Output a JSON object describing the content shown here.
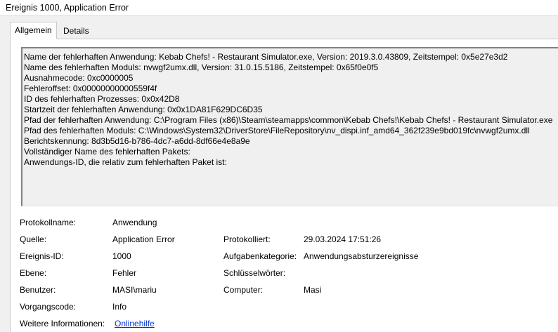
{
  "window": {
    "title": "Ereignis 1000, Application Error"
  },
  "tabs": [
    {
      "label": "Allgemein",
      "active": true
    },
    {
      "label": "Details",
      "active": false
    }
  ],
  "description": {
    "lines": [
      "Name der fehlerhaften Anwendung: Kebab Chefs! - Restaurant Simulator.exe, Version: 2019.3.0.43809, Zeitstempel: 0x5e27e3d2",
      "Name des fehlerhaften Moduls: nvwgf2umx.dll, Version: 31.0.15.5186, Zeitstempel: 0x65f0e0f5",
      "Ausnahmecode: 0xc0000005",
      "Fehleroffset: 0x00000000000559f4f",
      "ID des fehlerhaften Prozesses: 0x0x42D8",
      "Startzeit der fehlerhaften Anwendung: 0x0x1DA81F629DC6D35",
      "Pfad der fehlerhaften Anwendung: C:\\Program Files (x86)\\Steam\\steamapps\\common\\Kebab Chefs!\\Kebab Chefs! - Restaurant Simulator.exe",
      "Pfad des fehlerhaften Moduls: C:\\Windows\\System32\\DriverStore\\FileRepository\\nv_dispi.inf_amd64_362f239e9bd019fc\\nvwgf2umx.dll",
      "Berichtskennung: 8d3b5d16-b786-4dc7-a6dd-8df66e4e8a9e",
      "Vollständiger Name des fehlerhaften Pakets:",
      "Anwendungs-ID, die relativ zum fehlerhaften Paket ist:"
    ]
  },
  "details": {
    "protokollname": {
      "label": "Protokollname:",
      "value": "Anwendung"
    },
    "quelle": {
      "label": "Quelle:",
      "value": "Application Error"
    },
    "protokolliert": {
      "label": "Protokolliert:",
      "value": "29.03.2024 17:51:26"
    },
    "ereignis_id": {
      "label": "Ereignis-ID:",
      "value": "1000"
    },
    "aufgabenkategorie": {
      "label": "Aufgabenkategorie:",
      "value": "Anwendungsabsturzereignisse"
    },
    "ebene": {
      "label": "Ebene:",
      "value": "Fehler"
    },
    "schluesselwoerter": {
      "label": "Schlüsselwörter:",
      "value": ""
    },
    "benutzer": {
      "label": "Benutzer:",
      "value": "MASI\\mariu"
    },
    "computer": {
      "label": "Computer:",
      "value": "Masi"
    },
    "vorgangscode": {
      "label": "Vorgangscode:",
      "value": "Info"
    },
    "weitere_informationen": {
      "label": "Weitere Informationen:",
      "link": "Onlinehilfe"
    }
  }
}
